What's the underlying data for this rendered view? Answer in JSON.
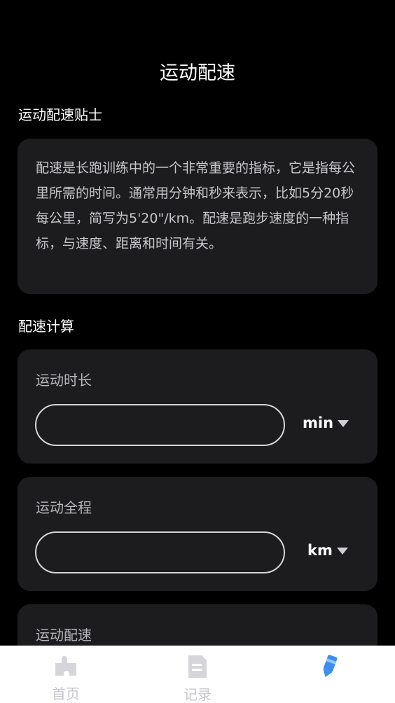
{
  "header": {
    "title": "运动配速"
  },
  "tips": {
    "heading": "运动配速贴士",
    "body": "配速是长跑训练中的一个非常重要的指标，它是指每公里所需的时间。通常用分钟和秒来表示，比如5分20秒每公里，简写为5'20\"/km。配速是跑步速度的一种指标，与速度、距离和时间有关。"
  },
  "calculator": {
    "heading": "配速计算",
    "duration": {
      "label": "运动时长",
      "value": "",
      "placeholder": "",
      "unit": "min"
    },
    "distance": {
      "label": "运动全程",
      "value": "",
      "placeholder": "",
      "unit": "km"
    },
    "pace": {
      "label": "运动配速"
    }
  },
  "tabbar": {
    "items": [
      {
        "label": "首页",
        "icon": "puzzle-icon"
      },
      {
        "label": "记录",
        "icon": "document-icon"
      },
      {
        "label": "",
        "icon": "pen-icon"
      }
    ],
    "active_index": 2,
    "colors": {
      "inactive": "#c7c7cc",
      "active": "#3b8ff0"
    }
  }
}
